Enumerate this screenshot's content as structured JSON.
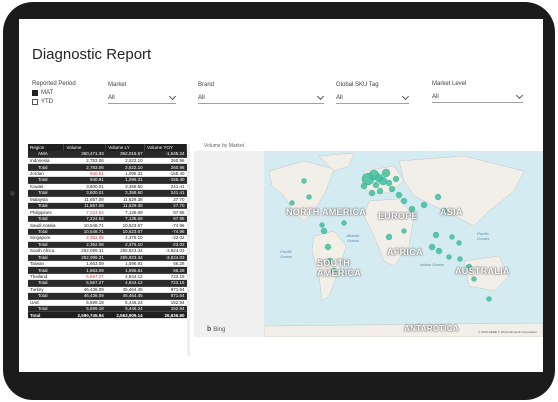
{
  "report": {
    "title": "Diagnostic Report"
  },
  "filters": {
    "reported_period": {
      "label": "Reported Period",
      "options": [
        {
          "label": "MAT",
          "checked": true
        },
        {
          "label": "YTD",
          "checked": false
        }
      ]
    },
    "market": {
      "label": "Market",
      "value": "All"
    },
    "brand": {
      "label": "Brand",
      "value": "All"
    },
    "global_sku_tag": {
      "label": "Global SKU Tag",
      "value": "All"
    },
    "market_level": {
      "label": "Market Level",
      "value": "All"
    }
  },
  "table": {
    "headers": [
      "Region",
      "Volume",
      "Volume LY",
      "Volume YOY"
    ],
    "rows": [
      {
        "region": "AMA",
        "volume": "350,471.33",
        "ly": "352,016.57",
        "yoy": "-1,545.24",
        "kind": "sub"
      },
      {
        "region": "Indonesia",
        "volume": "2,783.06",
        "ly": "2,522.10",
        "yoy": "260.96",
        "kind": "row"
      },
      {
        "region": "Total",
        "volume": "2,783.06",
        "ly": "2,522.10",
        "yoy": "260.96",
        "kind": "sub"
      },
      {
        "region": "Jordan",
        "volume": "940.91",
        "ly": "1,096.31",
        "yoy": "-155.40",
        "kind": "row"
      },
      {
        "region": "Total",
        "volume": "940.91",
        "ly": "1,096.31",
        "yoy": "-155.40",
        "kind": "sub"
      },
      {
        "region": "Kuwait",
        "volume": "3,600.01",
        "ly": "3,358.60",
        "yoy": "241.41",
        "kind": "row"
      },
      {
        "region": "Total",
        "volume": "3,600.01",
        "ly": "3,358.60",
        "yoy": "241.41",
        "kind": "sub"
      },
      {
        "region": "Malaysia",
        "volume": "11,657.08",
        "ly": "11,629.38",
        "yoy": "27.70",
        "kind": "row"
      },
      {
        "region": "Total",
        "volume": "11,657.08",
        "ly": "11,629.38",
        "yoy": "27.70",
        "kind": "sub"
      },
      {
        "region": "Philippines",
        "volume": "7,224.54",
        "ly": "7,136.69",
        "yoy": "87.85",
        "kind": "row"
      },
      {
        "region": "Total",
        "volume": "7,224.54",
        "ly": "7,136.69",
        "yoy": "87.85",
        "kind": "sub"
      },
      {
        "region": "Saudi Arabia",
        "volume": "10,548.71",
        "ly": "10,623.67",
        "yoy": "-74.96",
        "kind": "row"
      },
      {
        "region": "Total",
        "volume": "10,548.71",
        "ly": "10,623.67",
        "yoy": "-74.96",
        "kind": "sub"
      },
      {
        "region": "Singapore",
        "volume": "2,352.08",
        "ly": "2,375.10",
        "yoy": "-23.02",
        "kind": "row"
      },
      {
        "region": "Total",
        "volume": "2,352.08",
        "ly": "2,375.10",
        "yoy": "-23.02",
        "kind": "sub"
      },
      {
        "region": "South Africa",
        "volume": "252,099.31",
        "ly": "255,923.34",
        "yoy": "-3,824.03",
        "kind": "row"
      },
      {
        "region": "Total",
        "volume": "252,099.31",
        "ly": "255,923.34",
        "yoy": "-3,824.03",
        "kind": "sub"
      },
      {
        "region": "Taiwan",
        "volume": "1,663.09",
        "ly": "1,596.81",
        "yoy": "66.28",
        "kind": "row"
      },
      {
        "region": "Total",
        "volume": "1,663.09",
        "ly": "1,596.81",
        "yoy": "66.28",
        "kind": "sub"
      },
      {
        "region": "Thailand",
        "volume": "5,567.27",
        "ly": "4,844.12",
        "yoy": "723.15",
        "kind": "row"
      },
      {
        "region": "Total",
        "volume": "5,567.27",
        "ly": "4,844.12",
        "yoy": "723.15",
        "kind": "sub"
      },
      {
        "region": "Turkey",
        "volume": "46,436.09",
        "ly": "45,464.45",
        "yoy": "971.64",
        "kind": "row"
      },
      {
        "region": "Total",
        "volume": "46,436.09",
        "ly": "45,464.45",
        "yoy": "971.64",
        "kind": "sub"
      },
      {
        "region": "UAE",
        "volume": "5,599.18",
        "ly": "5,446.24",
        "yoy": "152.94",
        "kind": "row"
      },
      {
        "region": "Total",
        "volume": "5,599.18",
        "ly": "5,446.24",
        "yoy": "152.94",
        "kind": "sub"
      },
      {
        "region": "Total",
        "volume": "2,590,745.94",
        "ly": "2,563,909.14",
        "yoy": "26,836.80",
        "kind": "total"
      }
    ],
    "red_volume_rows": [
      3,
      9,
      13,
      19
    ]
  },
  "map": {
    "label": "Volume by Market",
    "continents": [
      "NORTH AMERICA",
      "EUROPE",
      "ASIA",
      "AFRICA",
      "SOUTH AMERICA",
      "AUSTRALIA",
      "ANTARCTICA"
    ],
    "oceans": [
      "Atlantic Ocean",
      "Pacific Ocean",
      "Indian Ocean",
      "Pacific Ocean"
    ],
    "provider": "Bing",
    "copyright": "© 2019 HERE © 2019 Microsoft Corporation",
    "bubble_color": "#3fbf9f"
  }
}
